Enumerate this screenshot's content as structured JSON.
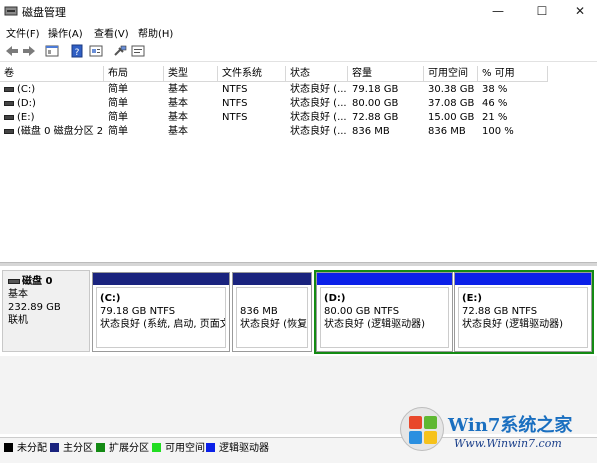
{
  "window": {
    "title": "磁盘管理",
    "minimize": "—",
    "maximize": "☐",
    "close": "✕"
  },
  "menu": [
    "文件(F)",
    "操作(A)",
    "查看(V)",
    "帮助(H)"
  ],
  "table": {
    "headers": [
      "卷",
      "布局",
      "类型",
      "文件系统",
      "状态",
      "容量",
      "可用空间",
      "% 可用"
    ],
    "rows": [
      [
        "(C:)",
        "简单",
        "基本",
        "NTFS",
        "状态良好 (...",
        "79.18 GB",
        "30.38 GB",
        "38 %"
      ],
      [
        "(D:)",
        "简单",
        "基本",
        "NTFS",
        "状态良好 (...",
        "80.00 GB",
        "37.08 GB",
        "46 %"
      ],
      [
        "(E:)",
        "简单",
        "基本",
        "NTFS",
        "状态良好 (...",
        "72.88 GB",
        "15.00 GB",
        "21 %"
      ],
      [
        "(磁盘 0 磁盘分区 2)",
        "简单",
        "基本",
        "",
        "状态良好 (...",
        "836 MB",
        "836 MB",
        "100 %"
      ]
    ]
  },
  "disk": {
    "name": "磁盘 0",
    "type": "基本",
    "size": "232.89 GB",
    "status": "联机"
  },
  "partitions": [
    {
      "label": "(C:)",
      "size": "79.18 GB NTFS",
      "status": "状态良好 (系统, 启动, 页面文件"
    },
    {
      "label": "",
      "size": "836 MB",
      "status": "状态良好 (恢复分"
    },
    {
      "label": "(D:)",
      "size": "80.00 GB NTFS",
      "status": "状态良好 (逻辑驱动器)"
    },
    {
      "label": "(E:)",
      "size": "72.88 GB NTFS",
      "status": "状态良好 (逻辑驱动器)"
    }
  ],
  "legend": [
    {
      "label": "未分配",
      "color": "#000000"
    },
    {
      "label": "主分区",
      "color": "#1a237e"
    },
    {
      "label": "扩展分区",
      "color": "#138a13"
    },
    {
      "label": "可用空间",
      "color": "#22dd22"
    },
    {
      "label": "逻辑驱动器",
      "color": "#0b20e8"
    }
  ],
  "watermark": {
    "title": "Win7系统之家",
    "url": "Www.Winwin7.com"
  }
}
